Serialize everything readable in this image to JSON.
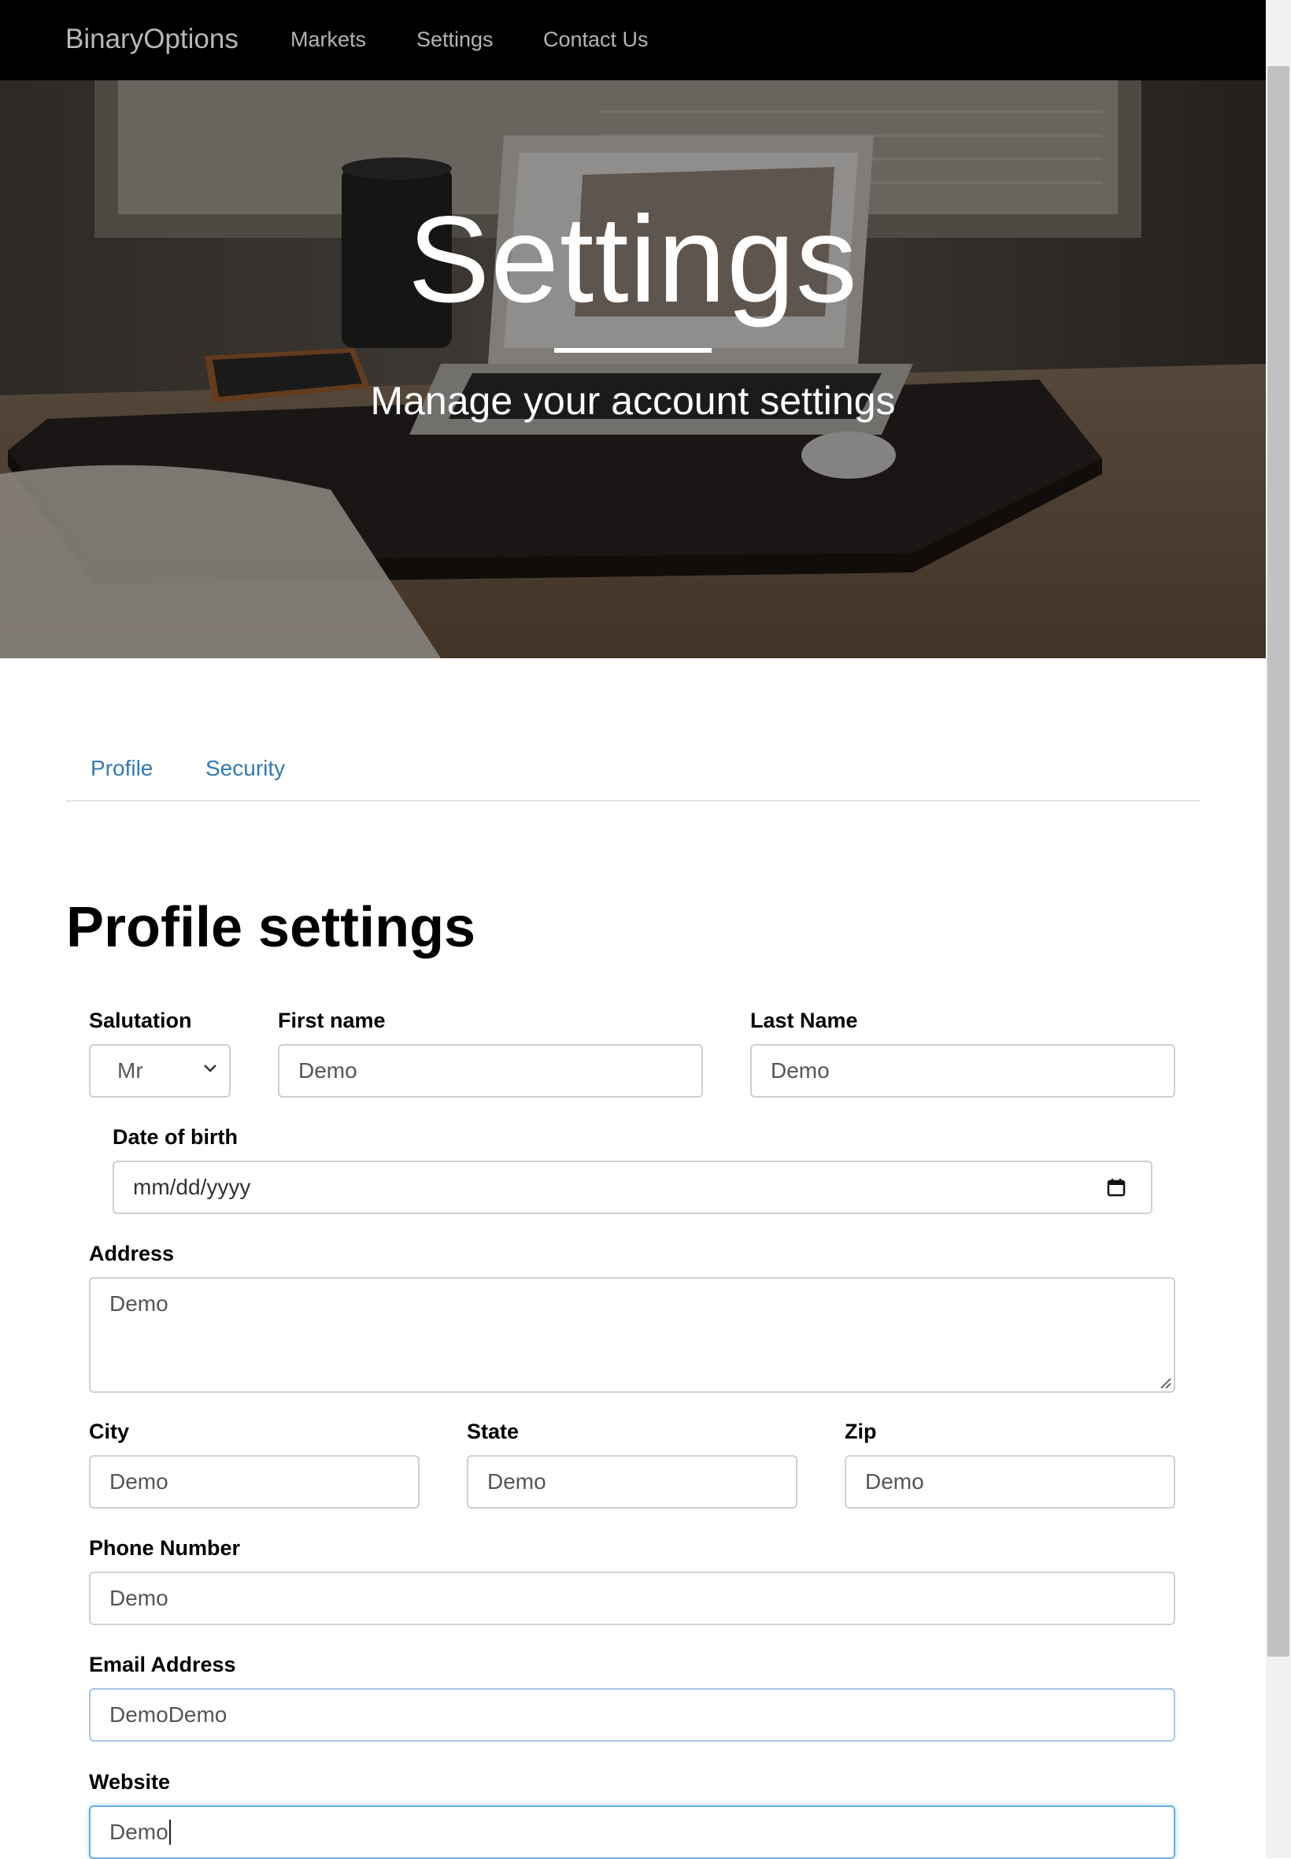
{
  "navbar": {
    "brand": "BinaryOptions",
    "links": [
      "Markets",
      "Settings",
      "Contact Us"
    ]
  },
  "hero": {
    "title": "Settings",
    "subtitle": "Manage your account settings"
  },
  "tabs": [
    {
      "label": "Profile"
    },
    {
      "label": "Security"
    }
  ],
  "form": {
    "title": "Profile settings",
    "salutation": {
      "label": "Salutation",
      "value": "Mr"
    },
    "first_name": {
      "label": "First name",
      "value": "Demo"
    },
    "last_name": {
      "label": "Last Name",
      "value": "Demo"
    },
    "dob": {
      "label": "Date of birth",
      "placeholder": "mm/dd/yyyy"
    },
    "address": {
      "label": "Address",
      "value": "Demo"
    },
    "city": {
      "label": "City",
      "value": "Demo"
    },
    "state": {
      "label": "State",
      "value": "Demo"
    },
    "zip": {
      "label": "Zip",
      "value": "Demo"
    },
    "phone": {
      "label": "Phone Number",
      "value": "Demo"
    },
    "email": {
      "label": "Email Address",
      "value": "DemoDemo"
    },
    "website": {
      "label": "Website",
      "value": "Demo"
    }
  },
  "icons": {
    "select": "chevron-down-icon",
    "date": "calendar-icon",
    "textarea": "resize-grip-icon"
  },
  "colors": {
    "navbar_bg": "#000000",
    "nav_text": "#b4b4b4",
    "tab_link": "#337ab7",
    "focus_border": "#66afe9"
  }
}
